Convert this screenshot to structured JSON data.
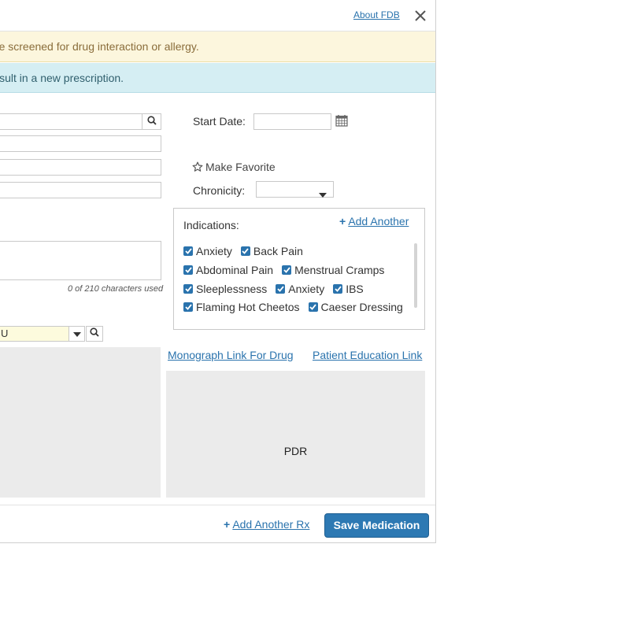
{
  "header": {
    "about_link": "About FDB"
  },
  "banners": {
    "warning": "Medications entered as free text will not be screened for drug interaction or allergy.",
    "info": "Saving this medication will not result in a new prescription."
  },
  "form": {
    "start_date_label": "Start Date:",
    "start_date_value": "",
    "make_favorite_label": "Make Favorite",
    "chronicity_label": "Chronicity:",
    "chronicity_value": "",
    "char_count": "0 of 210 characters used",
    "pharmacy_value": "U"
  },
  "indications": {
    "title": "Indications:",
    "add_another": "Add Another",
    "rows": [
      [
        "Anxiety",
        "Back Pain"
      ],
      [
        "Abdominal Pain",
        "Menstrual Cramps"
      ],
      [
        "Sleeplessness",
        "Anxiety",
        "IBS"
      ],
      [
        "Flaming Hot Cheetos",
        "Caeser Dressing"
      ]
    ]
  },
  "links": {
    "monograph": "Monograph Link For Drug",
    "patient_education": "Patient Education Link"
  },
  "panels": {
    "pdr_label": "PDR"
  },
  "footer": {
    "add_another_rx": "Add Another Rx",
    "save": "Save Medication"
  },
  "colors": {
    "accent": "#2a73ad",
    "save_button": "#2d79b3",
    "warning_bg": "#fcf6dd",
    "info_bg": "#d5eef3",
    "panel_bg": "#ebebeb"
  }
}
